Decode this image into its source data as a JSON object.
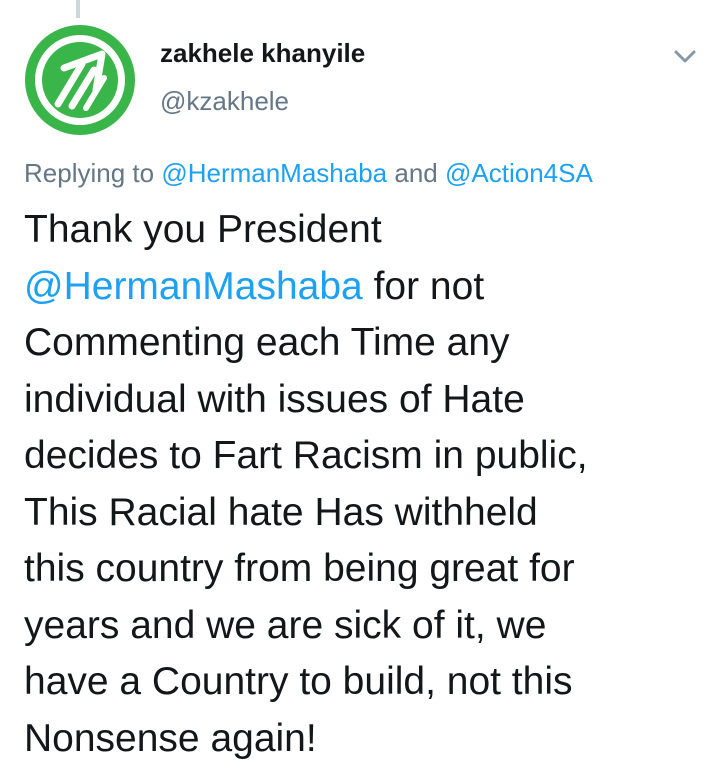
{
  "author": {
    "name": "zakhele khanyile",
    "handle": "@kzakhele",
    "avatar_icon": "green-arrow-logo-icon"
  },
  "reply_to": {
    "prefix": "Replying to",
    "mention_1": "@HermanMashaba",
    "conjunction": "and",
    "mention_2": "@Action4SA"
  },
  "tweet": {
    "line_1": "Thank you President",
    "line_2_mention": "@HermanMashaba",
    "line_2_rest": " for not",
    "line_3": "Commenting each Time any",
    "line_4": "individual with issues of Hate",
    "line_5": "decides to Fart Racism in public,",
    "line_6": "This Racial hate Has withheld",
    "line_7": "this country from being great for",
    "line_8": "years and we are sick of it, we",
    "line_9": "have a Country to build, not this",
    "line_10": "Nonsense again!"
  },
  "menu_icon": "chevron-down-icon",
  "colors": {
    "link": "#1da1f2",
    "secondary_text": "#657786",
    "avatar_green": "#39b54a"
  }
}
